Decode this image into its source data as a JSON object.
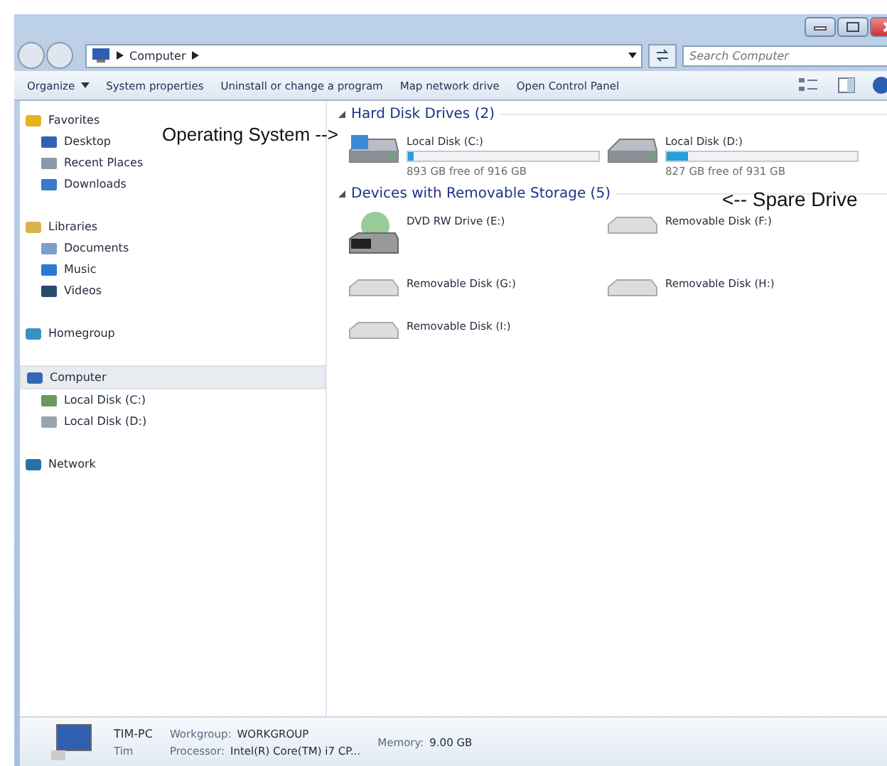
{
  "address_bar": {
    "path": [
      "Computer"
    ],
    "search_placeholder": "Search Computer"
  },
  "toolbar": {
    "items": [
      {
        "label": "Organize",
        "dropdown": true
      },
      {
        "label": "System properties",
        "dropdown": false
      },
      {
        "label": "Uninstall or change a program",
        "dropdown": false
      },
      {
        "label": "Map network drive",
        "dropdown": false
      },
      {
        "label": "Open Control Panel",
        "dropdown": false
      }
    ]
  },
  "sidebar": {
    "groups": [
      {
        "label": "Favorites",
        "selected": false,
        "children": [
          {
            "label": "Desktop",
            "selected": false
          },
          {
            "label": "Recent Places",
            "selected": false
          },
          {
            "label": "Downloads",
            "selected": false
          }
        ]
      },
      {
        "label": "Libraries",
        "selected": false,
        "children": [
          {
            "label": "Documents",
            "selected": false
          },
          {
            "label": "Music",
            "selected": false
          },
          {
            "label": "Videos",
            "selected": false
          }
        ]
      },
      {
        "label": "Homegroup",
        "selected": false
      },
      {
        "label": "Computer",
        "selected": true,
        "children": [
          {
            "label": "Local Disk (C:)",
            "selected": false
          },
          {
            "label": "Local Disk (D:)",
            "selected": false
          }
        ]
      },
      {
        "label": "Network",
        "selected": false
      }
    ]
  },
  "sections": [
    {
      "title": "Hard Disk Drives (2)",
      "items": [
        {
          "kind": "hdd",
          "name": "Local Disk (C:)",
          "os": true,
          "level": 0.03,
          "reading": "893 GB free of 916 GB"
        },
        {
          "kind": "hdd",
          "name": "Local Disk (D:)",
          "os": false,
          "level": 0.11,
          "reading": "827 GB free of 931 GB"
        }
      ]
    },
    {
      "title": "Devices with Removable Storage (5)",
      "items": [
        {
          "kind": "dvd",
          "name": "DVD RW Drive (E:)"
        },
        {
          "kind": "removable",
          "name": "Removable Disk (F:)"
        },
        {
          "kind": "removable",
          "name": "Removable Disk (G:)"
        },
        {
          "kind": "removable",
          "name": "Removable Disk (H:)"
        },
        {
          "kind": "removable",
          "name": "Removable Disk (I:)"
        }
      ]
    }
  ],
  "annotations": [
    {
      "kind": "left",
      "text": "Operating System -->"
    },
    {
      "kind": "right",
      "text": "<-- Spare Drive"
    }
  ],
  "details": {
    "name": "TIM-PC",
    "user": "Tim",
    "workgroup_label": "Workgroup:",
    "workgroup": "WORKGROUP",
    "processor_label": "Processor:",
    "processor": "Intel(R) Core(TM) i7 CP...",
    "memory_label": "Memory:",
    "memory": "9.00 GB"
  }
}
